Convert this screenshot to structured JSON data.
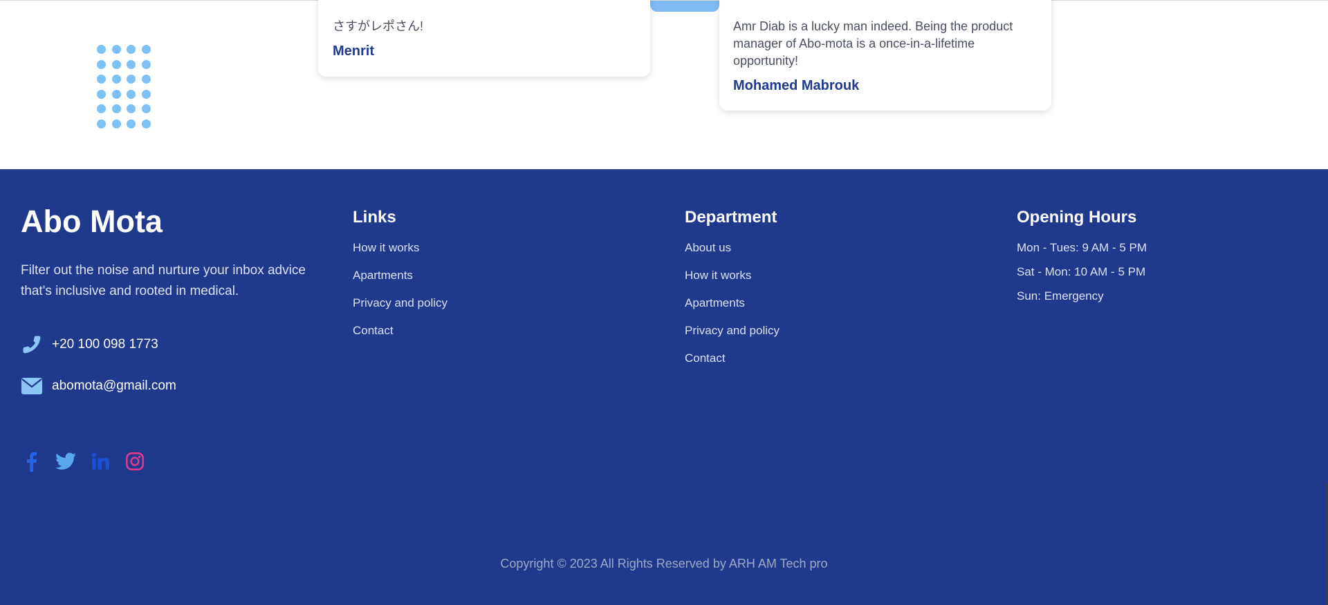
{
  "testimonials": [
    {
      "quote": "さすがレポさん!",
      "author": "Menrit"
    },
    {
      "quote": "Amr Diab is a lucky man indeed. Being the product manager of Abo-mota is a once-in-a-lifetime opportunity!",
      "author": "Mohamed Mabrouk"
    }
  ],
  "footer": {
    "brand": "Abo Mota",
    "tagline": "Filter out the noise and nurture your inbox advice that's inclusive and rooted in medical.",
    "phone": "+20 100 098 1773",
    "email": "abomota@gmail.com",
    "phone_icon": "phone-icon",
    "email_icon": "envelope-icon",
    "socials": [
      {
        "name": "facebook",
        "color": "#2563eb"
      },
      {
        "name": "twitter",
        "color": "#5aa7ec"
      },
      {
        "name": "linkedin",
        "color": "#1d4ed8"
      },
      {
        "name": "instagram",
        "color": "#e03a8c"
      }
    ],
    "links": {
      "title": "Links",
      "items": [
        "How it works",
        "Apartments",
        "Privacy and policy",
        "Contact"
      ]
    },
    "department": {
      "title": "Department",
      "items": [
        "About us",
        "How it works",
        "Apartments",
        "Privacy and policy",
        "Contact"
      ]
    },
    "hours": {
      "title": "Opening Hours",
      "items": [
        "Mon - Tues: 9 AM - 5 PM",
        "Sat - Mon: 10 AM - 5 PM",
        "Sun: Emergency"
      ]
    },
    "copyright": "Copyright © 2023 All Rights Reserved by ARH AM Tech pro"
  },
  "colors": {
    "footer_bg": "#1f3a8c",
    "accent_blue": "#1f3a8f",
    "dot_blue": "#7cc2f5",
    "icon_light_blue": "#8ec5f7"
  }
}
